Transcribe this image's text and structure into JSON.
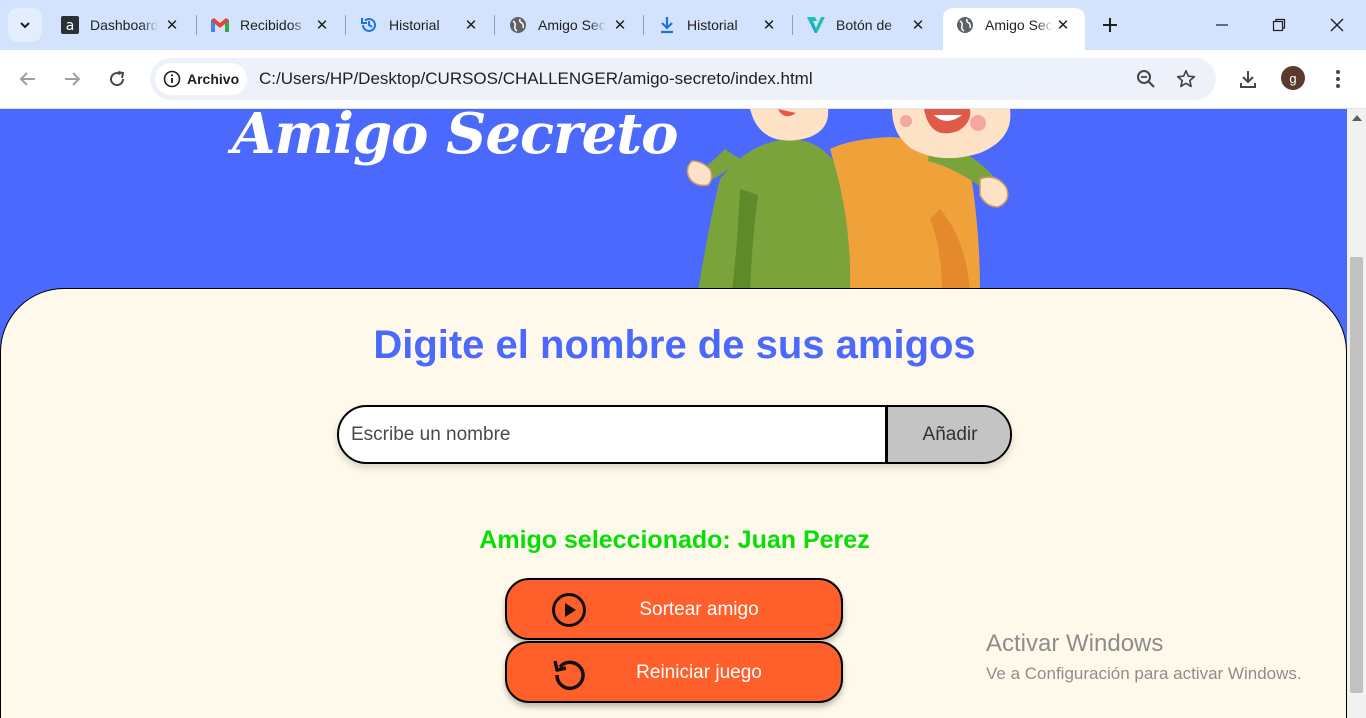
{
  "browser": {
    "tabs": [
      {
        "title": "Dashboard",
        "icon": "site-a-icon"
      },
      {
        "title": "Recibidos",
        "icon": "gmail-icon"
      },
      {
        "title": "Historial",
        "icon": "history-icon"
      },
      {
        "title": "Amigo Secreto",
        "icon": "globe-icon"
      },
      {
        "title": "Historial",
        "icon": "download-icon"
      },
      {
        "title": "Botón de",
        "icon": "vuetify-icon"
      },
      {
        "title": "Amigo Secreto",
        "icon": "globe-icon"
      }
    ],
    "active_tab": 6,
    "profile_initial": "g",
    "site_chip": "Archivo",
    "url": "C:/Users/HP/Desktop/CURSOS/CHALLENGER/amigo-secreto/index.html"
  },
  "page": {
    "header_title": "Amigo Secreto",
    "section_title": "Digite el nombre de sus amigos",
    "input_placeholder": "Escribe un nombre",
    "add_button": "Añadir",
    "result_text": "Amigo seleccionado: Juan Perez",
    "draw_button": "Sortear amigo",
    "reset_button": "Reiniciar juego"
  },
  "watermark": {
    "title": "Activar Windows",
    "subtitle": "Ve a Configuración para activar Windows."
  },
  "colors": {
    "accent_blue": "#4b69fd",
    "card_bg": "#fff9eb",
    "button_orange": "#ff5f2a",
    "result_green": "#05df05"
  }
}
